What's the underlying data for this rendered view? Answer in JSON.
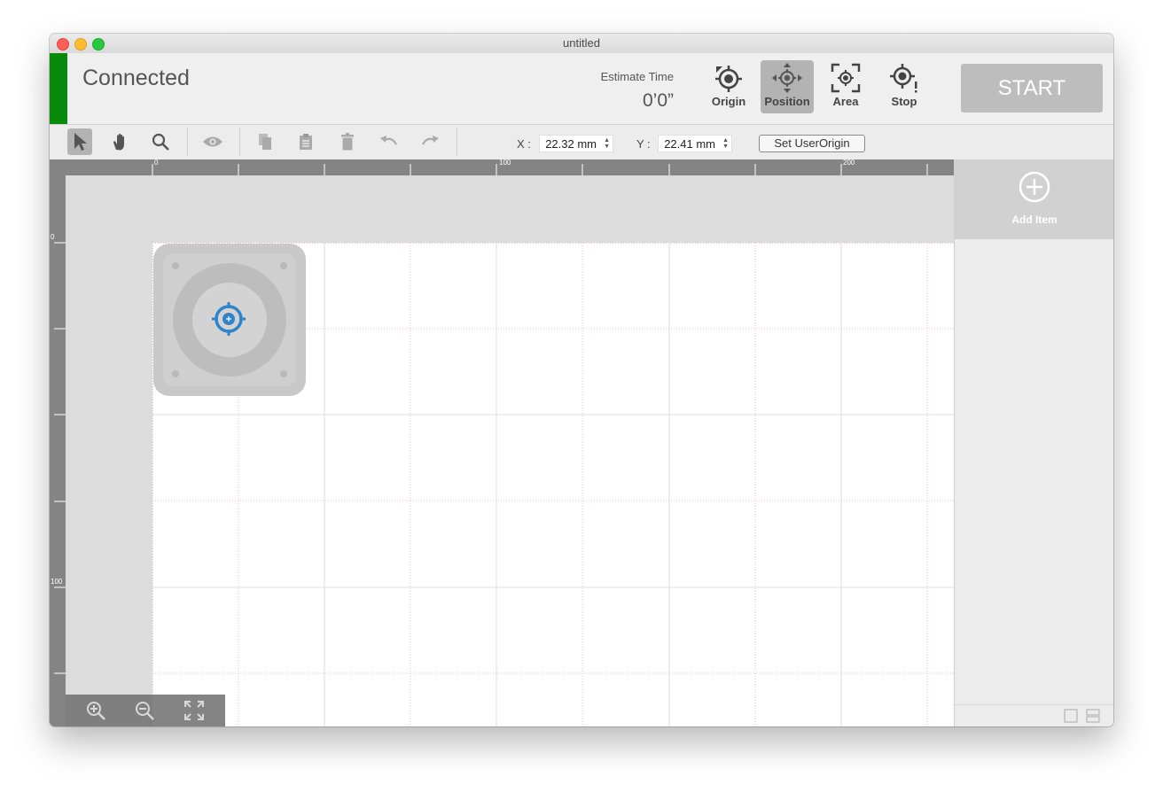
{
  "window": {
    "title": "untitled"
  },
  "header": {
    "status": "Connected",
    "status_color": "#0a8a0a",
    "estimate_label": "Estimate Time",
    "estimate_value": "0’0”",
    "tools": [
      {
        "label": "Origin",
        "icon": "origin-icon",
        "active": false
      },
      {
        "label": "Position",
        "icon": "position-move-icon",
        "active": true
      },
      {
        "label": "Area",
        "icon": "area-frame-icon",
        "active": false
      },
      {
        "label": "Stop",
        "icon": "stop-alert-icon",
        "active": false
      }
    ],
    "start_label": "START"
  },
  "toolbar": {
    "tools": [
      "select-arrow-icon",
      "hand-pan-icon",
      "magnifier-icon",
      "eye-icon",
      "copy-icon",
      "paste-icon",
      "trash-icon",
      "undo-icon",
      "redo-icon"
    ],
    "selected_tool": "select-arrow-icon",
    "x_label": "X :",
    "x_value": "22.32 mm",
    "y_label": "Y :",
    "y_value": "22.41 mm",
    "set_origin_label": "Set UserOrigin"
  },
  "rulers": {
    "top_labels": [
      "0",
      "100",
      "200"
    ],
    "left_labels": [
      "0",
      "100"
    ]
  },
  "side_panel": {
    "add_item_label": "Add Item"
  },
  "zoom_controls": [
    "zoom-in-icon",
    "zoom-out-icon",
    "fit-screen-icon"
  ]
}
